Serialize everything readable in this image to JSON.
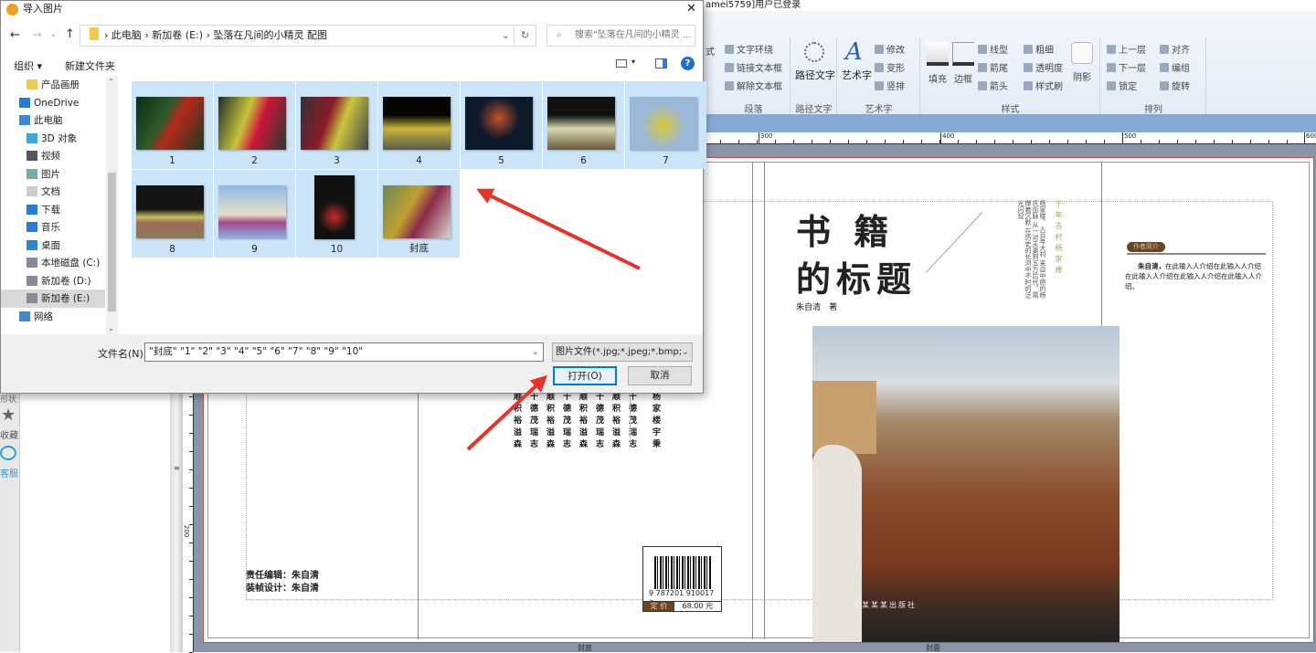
{
  "app": {
    "title_fragment": "amei5759]用户已登录",
    "ribbon": {
      "groups": [
        {
          "label": "段落",
          "items": [
            "文字环绕",
            "链接文本框",
            "解除文本框"
          ]
        },
        {
          "label": "路径文字",
          "items": [
            "路径文字"
          ]
        },
        {
          "label": "艺术字",
          "items": [
            "艺术字",
            "修改",
            "变形",
            "竖排"
          ]
        },
        {
          "label": "样式",
          "items": [
            "填充",
            "边框",
            "线型",
            "箭尾",
            "箭头",
            "粗细",
            "透明度",
            "样式刷",
            "阴影"
          ]
        },
        {
          "label": "排列",
          "items": [
            "上一层",
            "下一层",
            "锁定",
            "对齐",
            "编组",
            "旋转"
          ]
        }
      ],
      "edge_fragment": "式"
    },
    "ruler": {
      "h": [
        "300",
        "400",
        "500",
        "600"
      ],
      "v": "200"
    },
    "left_panel": {
      "top_fragment": "形状",
      "favorites": "收藏",
      "service": "客服"
    },
    "cover": {
      "title_line1": "书 籍",
      "title_line2": "的标题",
      "author": "朱自清　著",
      "spine_title": "千年古村杨家楼",
      "spine_text": [
        "杨家楼，入百年大村",
        "来自中原的杨氏血脉",
        "从一对夫妻到五万后代，需撑着沉默",
        "在历史的长河中不时的泛光闪现"
      ],
      "intro_badge": "作者简介",
      "intro_name": "朱自清，",
      "intro_text": "在此输入人介绍在此输入人介绍在此输入人介绍在此输入人介绍在此输入人介绍。",
      "publisher": "某某某某出版社",
      "back_columns": [
        "顺积裕溢森",
        "千德茂瑞志",
        "顺积裕溢森",
        "千德茂瑞志",
        "顺积裕溢森",
        "千德茂瑞志",
        "顺积裕溢森",
        "千德茂瑞志"
      ],
      "back_side": "杨家楼宇秉",
      "editor": "责任编辑：朱自清",
      "designer": "装帧设计：朱自清",
      "isbn": "9 787201 910017 >",
      "price_label": "定 价",
      "price": "68.00 元",
      "label_back": "封底",
      "label_front": "封面"
    }
  },
  "dialog": {
    "title": "导入图片",
    "close": "✕",
    "breadcrumb": [
      "此电脑",
      "新加卷 (E:)",
      "坠落在凡间的小精灵  配图"
    ],
    "search_placeholder": "搜索\"坠落在凡间的小精灵 ...",
    "toolbar": {
      "organize": "组织 ▾",
      "new_folder": "新建文件夹"
    },
    "nav": [
      "产品画册",
      "OneDrive",
      "此电脑",
      "3D 对象",
      "视频",
      "图片",
      "文档",
      "下载",
      "音乐",
      "桌面",
      "本地磁盘 (C:)",
      "新加卷 (D:)",
      "新加卷 (E:)",
      "网络"
    ],
    "files": [
      {
        "name": "1",
        "bg": "linear-gradient(120deg,#0d2a16,#2c5a2a 40%,#b5281c 55%,#1c3a1e)"
      },
      {
        "name": "2",
        "bg": "linear-gradient(110deg,#1c2e2a,#c9c23a 40%,#c9163a 60%,#2a3a30)"
      },
      {
        "name": "3",
        "bg": "linear-gradient(110deg,#333,#8a1a2a 40%,#c9c640 60%,#444)"
      },
      {
        "name": "4",
        "bg": "linear-gradient(180deg,#050505 35%,#c9b43a 60%,#5a5a4a)"
      },
      {
        "name": "5",
        "bg": "radial-gradient(circle at 50% 40%,#c4502a,#0c1a2a 45%)"
      },
      {
        "name": "6",
        "bg": "linear-gradient(180deg,#111 35%,#d8d6b0 60%,#6a5a3a)"
      },
      {
        "name": "7",
        "bg": "radial-gradient(circle at 50% 55%,#d8c83a,#9ab8d8 50%)"
      },
      {
        "name": "8",
        "bg": "linear-gradient(180deg,#151515 45%,#c9c060 60%,#a06a5a 70%,#8a7a5a)"
      },
      {
        "name": "9",
        "bg": "linear-gradient(180deg,#8ab8e8,#e8e0c8 55%,#a04a8a 70%,#8ab0e0)"
      },
      {
        "name": "10",
        "bg": "radial-gradient(circle at 50% 65%,#c0302a,#111 35%)"
      },
      {
        "name": "封底",
        "bg": "linear-gradient(120deg,#6a8a5a,#c0a030 40%,#8a2a4a 60%,#d8d8d0)"
      }
    ],
    "filename_label": "文件名(N):",
    "filename_value": "\"封底\" \"1\" \"2\" \"3\" \"4\" \"5\" \"6\" \"7\" \"8\" \"9\" \"10\"",
    "filetype": "图片文件(*.jpg;*.jpeg;*.bmp;*.",
    "open": "打开(O)",
    "cancel": "取消"
  },
  "colors": {
    "arrow": "#e8332a",
    "selection": "#cce4f7",
    "accent_brown": "#6b4423"
  }
}
